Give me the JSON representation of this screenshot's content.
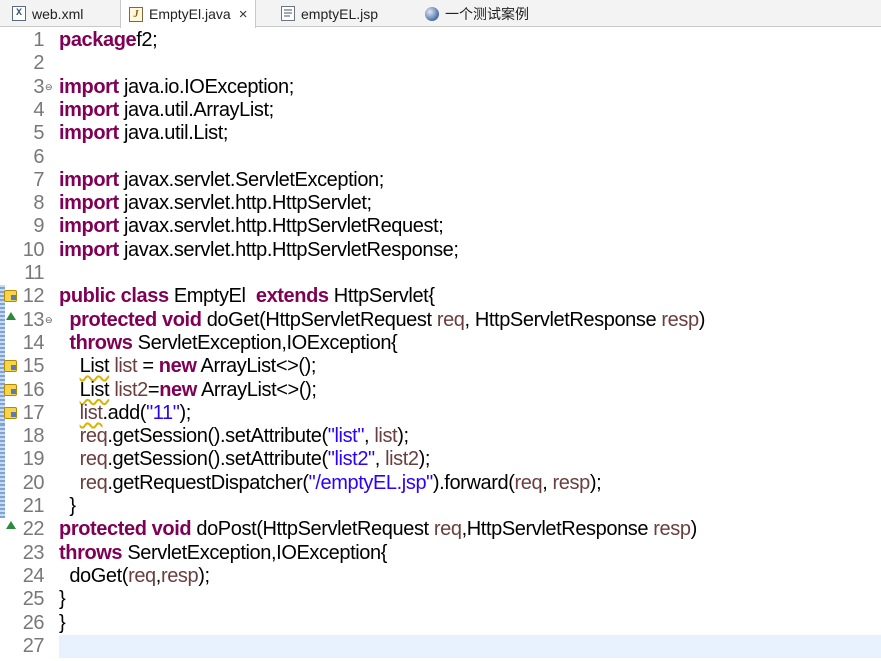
{
  "tabs": [
    {
      "label": "web.xml",
      "icon": "xml-file-icon",
      "active": false
    },
    {
      "label": "EmptyEl.java",
      "icon": "java-file-icon",
      "active": true,
      "close": "×"
    },
    {
      "label": "emptyEL.jsp",
      "icon": "jsp-file-icon",
      "active": false
    },
    {
      "label": "一个测试案例",
      "icon": "globe-icon",
      "active": false
    }
  ],
  "editor": {
    "line_numbers": [
      "1",
      "2",
      "3",
      "4",
      "5",
      "6",
      "7",
      "8",
      "9",
      "10",
      "11",
      "12",
      "13",
      "14",
      "15",
      "16",
      "17",
      "18",
      "19",
      "20",
      "21",
      "22",
      "23",
      "24",
      "25",
      "26",
      "27"
    ],
    "lines": [
      [
        [
          "kw",
          "package"
        ],
        [
          "",
          "f2;"
        ]
      ],
      [],
      [
        [
          "kw",
          "import"
        ],
        [
          "",
          " java.io.IOException;"
        ]
      ],
      [
        [
          "kw",
          "import"
        ],
        [
          "",
          " java.util.ArrayList;"
        ]
      ],
      [
        [
          "kw",
          "import"
        ],
        [
          "",
          " java.util.List;"
        ]
      ],
      [],
      [
        [
          "kw",
          "import"
        ],
        [
          "",
          " javax.servlet.ServletException;"
        ]
      ],
      [
        [
          "kw",
          "import"
        ],
        [
          "",
          " javax.servlet.http.HttpServlet;"
        ]
      ],
      [
        [
          "kw",
          "import"
        ],
        [
          "",
          " javax.servlet.http.HttpServletRequest;"
        ]
      ],
      [
        [
          "kw",
          "import"
        ],
        [
          "",
          " javax.servlet.http.HttpServletResponse;"
        ]
      ],
      [],
      [
        [
          "kw",
          "public class"
        ],
        [
          "",
          " EmptyEl  "
        ],
        [
          "kw",
          "extends"
        ],
        [
          "",
          " HttpServlet{"
        ]
      ],
      [
        [
          "",
          "  "
        ],
        [
          "kw",
          "protected void"
        ],
        [
          "",
          " doGet(HttpServletRequest "
        ],
        [
          "var",
          "req"
        ],
        [
          "",
          ", HttpServletResponse "
        ],
        [
          "var",
          "resp"
        ],
        [
          "",
          ")"
        ]
      ],
      [
        [
          "",
          "  "
        ],
        [
          "kw",
          "throws"
        ],
        [
          "",
          " ServletException,IOException{"
        ]
      ],
      [
        [
          "",
          "    "
        ],
        [
          "warn",
          "List"
        ],
        [
          "",
          " "
        ],
        [
          "var",
          "list"
        ],
        [
          "",
          " = "
        ],
        [
          "kw",
          "new"
        ],
        [
          "",
          " ArrayList<>();"
        ]
      ],
      [
        [
          "",
          "    "
        ],
        [
          "warn",
          "List"
        ],
        [
          "",
          " "
        ],
        [
          "var",
          "list2"
        ],
        [
          "",
          "="
        ],
        [
          "kw",
          "new"
        ],
        [
          "",
          " ArrayList<>();"
        ]
      ],
      [
        [
          "",
          "    "
        ],
        [
          "varwarn",
          "list"
        ],
        [
          "",
          ".add("
        ],
        [
          "str",
          "\"11\""
        ],
        [
          "",
          ");"
        ]
      ],
      [
        [
          "",
          "    "
        ],
        [
          "var",
          "req"
        ],
        [
          "",
          ".getSession().setAttribute("
        ],
        [
          "str",
          "\"list\""
        ],
        [
          "",
          ", "
        ],
        [
          "var",
          "list"
        ],
        [
          "",
          ");"
        ]
      ],
      [
        [
          "",
          "    "
        ],
        [
          "var",
          "req"
        ],
        [
          "",
          ".getSession().setAttribute("
        ],
        [
          "str",
          "\"list2\""
        ],
        [
          "",
          ", "
        ],
        [
          "var",
          "list2"
        ],
        [
          "",
          ");"
        ]
      ],
      [
        [
          "",
          "    "
        ],
        [
          "var",
          "req"
        ],
        [
          "",
          ".getRequestDispatcher("
        ],
        [
          "str",
          "\"/emptyEL.jsp\""
        ],
        [
          "",
          ").forward("
        ],
        [
          "var",
          "req"
        ],
        [
          "",
          ", "
        ],
        [
          "var",
          "resp"
        ],
        [
          "",
          ");"
        ]
      ],
      [
        [
          "",
          "  }"
        ]
      ],
      [
        [
          "kw",
          "protected void"
        ],
        [
          "",
          " doPost(HttpServletRequest "
        ],
        [
          "var",
          "req"
        ],
        [
          "",
          ",HttpServletResponse "
        ],
        [
          "var",
          "resp"
        ],
        [
          "",
          ")"
        ]
      ],
      [
        [
          "kw",
          "throws"
        ],
        [
          "",
          " ServletException,IOException{"
        ]
      ],
      [
        [
          "",
          "  doGet("
        ],
        [
          "var",
          "req"
        ],
        [
          "",
          ","
        ],
        [
          "var",
          "resp"
        ],
        [
          "",
          ");"
        ]
      ],
      [
        [
          "",
          "}"
        ]
      ],
      [
        [
          "",
          "}"
        ]
      ],
      []
    ],
    "current_line": 27,
    "fold_markers": {
      "3": "⊖",
      "13": "⊖",
      "22": ""
    },
    "warning_lines": [
      12,
      15,
      16,
      17
    ],
    "override_lines": [
      13,
      22
    ],
    "colors": {
      "keyword": "#7f0055",
      "string": "#2a00ff",
      "variable": "#6a3e3e",
      "line_number": "#787878",
      "current_line": "#e8f2fe"
    }
  }
}
